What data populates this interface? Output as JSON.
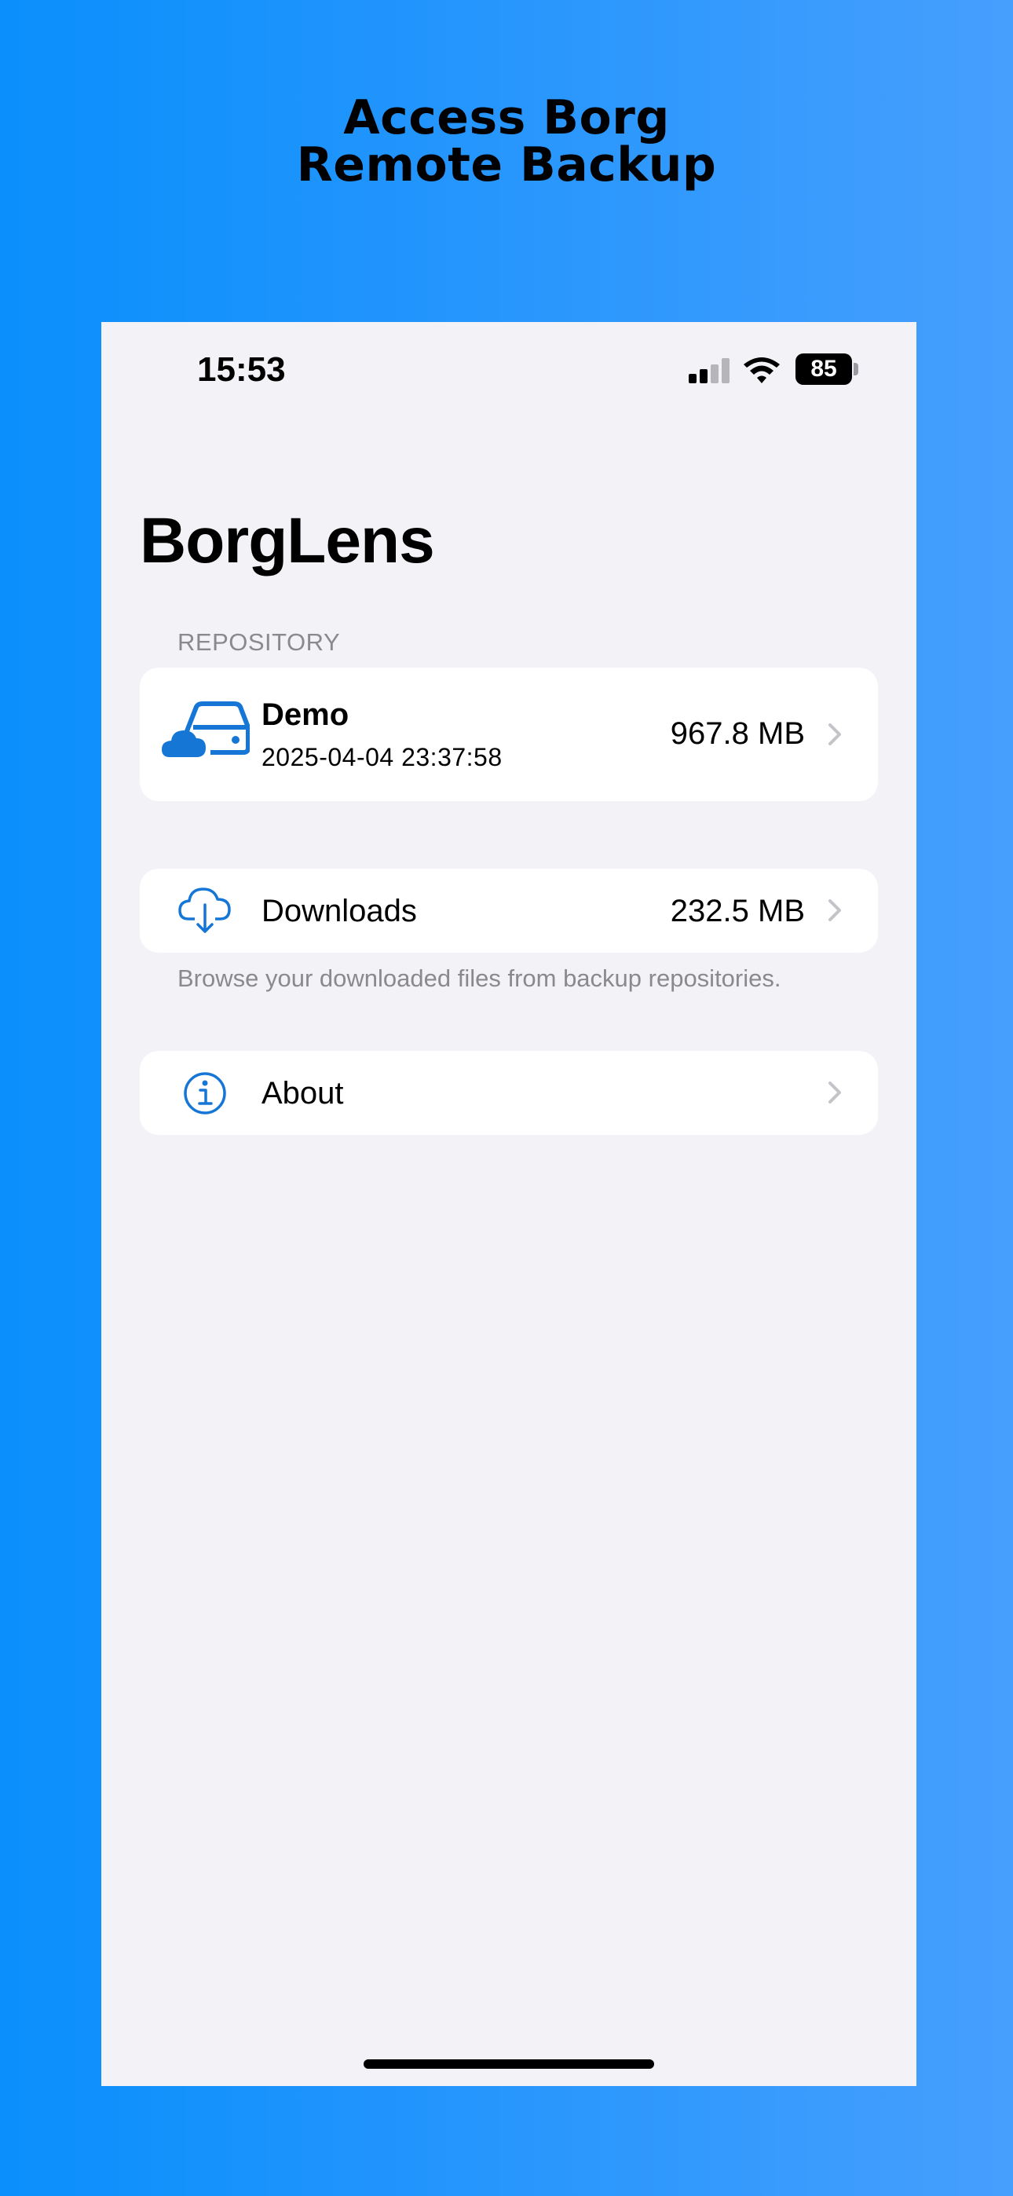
{
  "promo": {
    "headline_line1": "Access Borg",
    "headline_line2": "Remote Backup"
  },
  "status_bar": {
    "time": "15:53",
    "battery": "85"
  },
  "app": {
    "title": "BorgLens"
  },
  "repository_section": {
    "header": "REPOSITORY",
    "items": [
      {
        "name": "Demo",
        "date": "2025-04-04 23:37:58",
        "size": "967.8 MB",
        "icon": "cloud-drive-icon"
      }
    ]
  },
  "downloads": {
    "label": "Downloads",
    "size": "232.5 MB",
    "icon": "cloud-download-icon",
    "footer": "Browse your downloaded files from backup repositories."
  },
  "about": {
    "label": "About",
    "icon": "info-circle-icon"
  },
  "colors": {
    "accent": "#1576d6",
    "background": "#f2f2f7",
    "secondary_text": "#8a8a8e"
  }
}
